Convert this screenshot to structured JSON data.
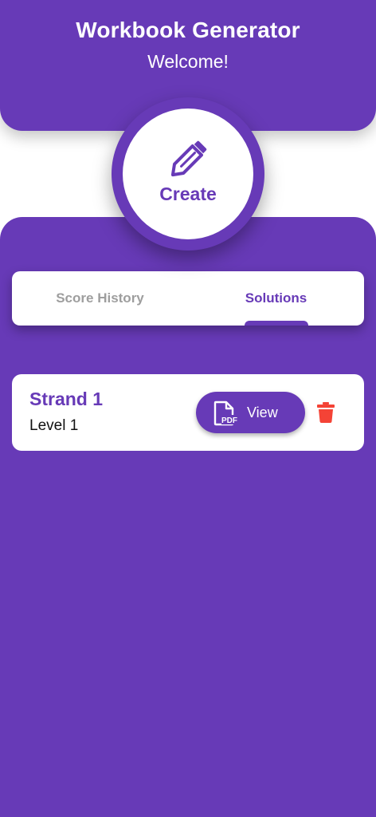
{
  "header": {
    "title": "Workbook Generator",
    "subtitle": "Welcome!"
  },
  "create": {
    "label": "Create",
    "icon": "pencil-icon"
  },
  "tabs": [
    {
      "label": "Score History",
      "selected": false
    },
    {
      "label": "Solutions",
      "selected": true
    }
  ],
  "list": {
    "items": [
      {
        "title": "Strand 1",
        "subtitle": "Level 1",
        "view_label": "View",
        "view_icon": "pdf-file-icon",
        "pdf_icon_text": "PDF",
        "delete_icon": "trash-icon"
      }
    ]
  },
  "colors": {
    "primary": "#673AB7",
    "surface": "#FFFFFF",
    "inactive_tab": "#9E9E9E",
    "delete": "#F44336"
  }
}
